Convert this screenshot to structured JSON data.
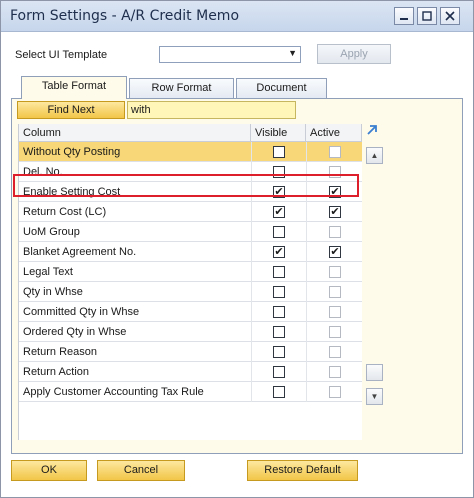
{
  "window": {
    "title": "Form Settings - A/R Credit Memo"
  },
  "controls": {
    "ui_template_label": "Select UI Template",
    "ui_template_value": "",
    "apply_label": "Apply"
  },
  "tabs": [
    {
      "label": "Table Format",
      "active": true
    },
    {
      "label": "Row Format",
      "active": false
    },
    {
      "label": "Document",
      "active": false
    }
  ],
  "find": {
    "button_label": "Find Next",
    "value": "with"
  },
  "table": {
    "headers": {
      "column": "Column",
      "visible": "Visible",
      "active": "Active"
    },
    "rows": [
      {
        "name": "Without Qty Posting",
        "visible": false,
        "active": false,
        "active_enabled": false,
        "selected": true
      },
      {
        "name": "Del. No.",
        "visible": false,
        "active": false,
        "active_enabled": false,
        "selected": false
      },
      {
        "name": "Enable Setting Cost",
        "visible": true,
        "active": true,
        "active_enabled": true,
        "selected": false
      },
      {
        "name": "Return Cost (LC)",
        "visible": true,
        "active": true,
        "active_enabled": true,
        "selected": false
      },
      {
        "name": "UoM Group",
        "visible": false,
        "active": false,
        "active_enabled": false,
        "selected": false
      },
      {
        "name": "Blanket Agreement No.",
        "visible": true,
        "active": true,
        "active_enabled": true,
        "selected": false
      },
      {
        "name": "Legal Text",
        "visible": false,
        "active": false,
        "active_enabled": false,
        "selected": false
      },
      {
        "name": "Qty in Whse",
        "visible": false,
        "active": false,
        "active_enabled": false,
        "selected": false
      },
      {
        "name": "Committed Qty in Whse",
        "visible": false,
        "active": false,
        "active_enabled": false,
        "selected": false
      },
      {
        "name": "Ordered Qty in Whse",
        "visible": false,
        "active": false,
        "active_enabled": false,
        "selected": false
      },
      {
        "name": "Return Reason",
        "visible": false,
        "active": false,
        "active_enabled": false,
        "selected": false
      },
      {
        "name": "Return Action",
        "visible": false,
        "active": false,
        "active_enabled": false,
        "selected": false
      },
      {
        "name": "Apply Customer Accounting Tax Rule",
        "visible": false,
        "active": false,
        "active_enabled": false,
        "selected": false
      }
    ]
  },
  "footer": {
    "ok_label": "OK",
    "cancel_label": "Cancel",
    "restore_label": "Restore Default"
  },
  "colors": {
    "accent": "#f2c648",
    "highlight_border": "#dc1f2b",
    "selected_row": "#f7d777"
  }
}
